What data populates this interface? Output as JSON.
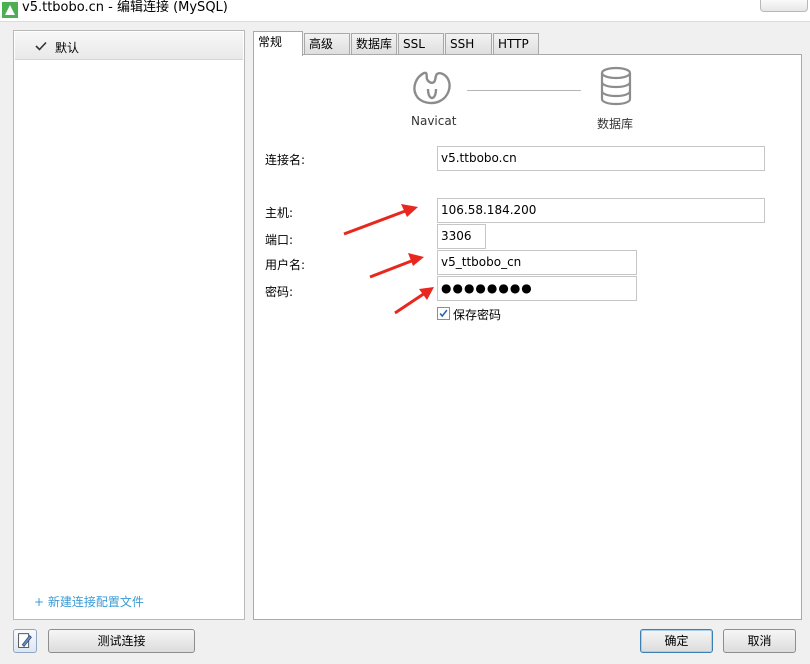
{
  "window": {
    "title": "v5.ttbobo.cn - 编辑连接 (MySQL)"
  },
  "sidebar": {
    "items": [
      {
        "label": "默认",
        "selected": true
      }
    ],
    "new_profile_link": "+ 新建连接配置文件"
  },
  "tabs": [
    {
      "label": "常规",
      "active": true
    },
    {
      "label": "高级"
    },
    {
      "label": "数据库"
    },
    {
      "label": "SSL"
    },
    {
      "label": "SSH"
    },
    {
      "label": "HTTP"
    }
  ],
  "diagram": {
    "left_caption": "Navicat",
    "right_caption": "数据库"
  },
  "form": {
    "connection_name": {
      "label": "连接名:",
      "value": "v5.ttbobo.cn"
    },
    "host": {
      "label": "主机:",
      "value": "106.58.184.200"
    },
    "port": {
      "label": "端口:",
      "value": "3306"
    },
    "username": {
      "label": "用户名:",
      "value": "v5_ttbobo_cn"
    },
    "password": {
      "label": "密码:",
      "value": "●●●●●●●●"
    },
    "save_password": {
      "label": "保存密码",
      "checked": true
    }
  },
  "buttons": {
    "test": "测试连接",
    "ok": "确定",
    "cancel": "取消"
  },
  "colors": {
    "accent_link": "#3a9bd6",
    "annotation_arrow": "#e8281e",
    "app_icon": "#4caf50"
  },
  "icons": {
    "app": "navicat-app-icon",
    "check": "check-icon",
    "navicat": "navicat-logo-icon",
    "database": "database-icon",
    "edit": "edit-icon"
  }
}
